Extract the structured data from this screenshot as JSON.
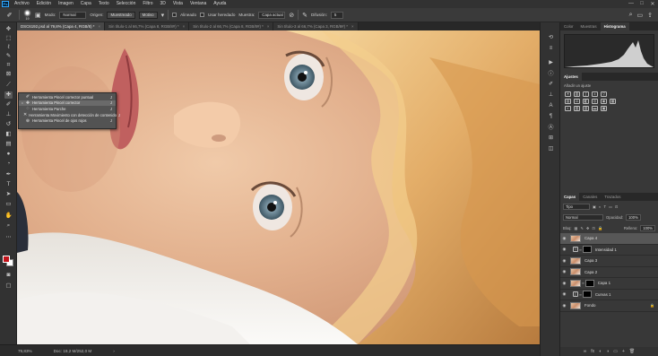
{
  "app": {
    "logo": "Ps"
  },
  "menu": [
    "Archivo",
    "Edición",
    "Imagen",
    "Capa",
    "Texto",
    "Selección",
    "Filtro",
    "3D",
    "Vista",
    "Ventana",
    "Ayuda"
  ],
  "window_controls": [
    "—",
    "□",
    "✕"
  ],
  "options_bar": {
    "brush_size": "19",
    "modo_label": "Modo:",
    "modo_value": "Normal",
    "origen_label": "Origen:",
    "origen_sampled": "Muestreado",
    "origen_pattern": "Motivo",
    "aligned_label": "Alineado",
    "legacy_label": "Usar heredado",
    "sample_label": "Muestra:",
    "sample_value": "Capa actual",
    "difusion_label": "Difusión:",
    "difusion_value": "5"
  },
  "tabs": [
    {
      "label": "DSC6192.psd al 79,8% (Capa 4, RGB/8) *",
      "active": true
    },
    {
      "label": "Sin título-1 al 66,7% (Capa 8, RGB/8#) *",
      "active": false
    },
    {
      "label": "Sin título-2 al 66,7% (Capa 8, RGB/8#) *",
      "active": false
    },
    {
      "label": "Sin título-3 al 66,7% (Capa 3, RGB/8#) *",
      "active": false
    }
  ],
  "tools": [
    {
      "icon": "move-icon",
      "glyph": "✥"
    },
    {
      "icon": "marquee-icon",
      "glyph": "⬚"
    },
    {
      "icon": "lasso-icon",
      "glyph": "ℓ"
    },
    {
      "icon": "quick-select-icon",
      "glyph": "✎"
    },
    {
      "icon": "crop-icon",
      "glyph": "⌗"
    },
    {
      "icon": "frame-icon",
      "glyph": "⊠"
    },
    {
      "icon": "eyedropper-icon",
      "glyph": "⟋"
    },
    {
      "icon": "healing-brush-icon",
      "glyph": "✚"
    },
    {
      "icon": "brush-icon",
      "glyph": "✐"
    },
    {
      "icon": "clone-stamp-icon",
      "glyph": "⊥"
    },
    {
      "icon": "history-brush-icon",
      "glyph": "↺"
    },
    {
      "icon": "eraser-icon",
      "glyph": "◧"
    },
    {
      "icon": "gradient-icon",
      "glyph": "▤"
    },
    {
      "icon": "blur-icon",
      "glyph": "●"
    },
    {
      "icon": "dodge-icon",
      "glyph": "◔"
    },
    {
      "icon": "pen-icon",
      "glyph": "✒"
    },
    {
      "icon": "type-icon",
      "glyph": "T"
    },
    {
      "icon": "path-select-icon",
      "glyph": "➤"
    },
    {
      "icon": "rectangle-icon",
      "glyph": "▭"
    },
    {
      "icon": "hand-icon",
      "glyph": "✋"
    },
    {
      "icon": "zoom-icon",
      "glyph": "⌕"
    },
    {
      "icon": "more-tools-icon",
      "glyph": "⋯"
    }
  ],
  "flyout": [
    {
      "label": "Herramienta Pincel corrector puntual",
      "key": "J",
      "selected": false,
      "bullet": ""
    },
    {
      "label": "Herramienta Pincel corrector",
      "key": "J",
      "selected": true,
      "bullet": "•"
    },
    {
      "label": "Herramienta Parche",
      "key": "J",
      "selected": false,
      "bullet": ""
    },
    {
      "label": "Herramienta Movimiento con detección de contenido",
      "key": "J",
      "selected": false,
      "bullet": ""
    },
    {
      "label": "Herramienta Pincel de ojos rojos",
      "key": "J",
      "selected": false,
      "bullet": ""
    }
  ],
  "status": {
    "zoom": "79,83%",
    "doc": "Doc: 19,2 M/252,0 M"
  },
  "right_panel": {
    "top_tabs": [
      {
        "label": "Color",
        "active": false
      },
      {
        "label": "Muestras",
        "active": false
      },
      {
        "label": "Histograma",
        "active": true
      }
    ],
    "adjust_tab": "Ajustes",
    "adjust_hint": "Añadir un ajuste",
    "layer_tabs": [
      {
        "label": "Capas",
        "active": true
      },
      {
        "label": "Canales",
        "active": false
      },
      {
        "label": "Trazados",
        "active": false
      }
    ],
    "filter_kind": "Tipo",
    "blend_mode": "Normal",
    "opacity_label": "Opacidad:",
    "opacity_value": "100%",
    "lock_label": "Bloq:",
    "fill_label": "Relleno:",
    "fill_value": "100%",
    "layers": [
      {
        "name": "Capa 4",
        "kind": "pixel",
        "selected": true
      },
      {
        "name": "Intensidad 1",
        "kind": "adjust",
        "selected": false
      },
      {
        "name": "Capa 3",
        "kind": "pixel",
        "selected": false
      },
      {
        "name": "Capa 2",
        "kind": "pixel",
        "selected": false
      },
      {
        "name": "Capa 1",
        "kind": "pixel-mask",
        "selected": false
      },
      {
        "name": "Curvas 1",
        "kind": "adjust",
        "selected": false
      },
      {
        "name": "Fondo",
        "kind": "pixel",
        "selected": false
      }
    ],
    "bottom_icons": [
      "∞",
      "fx",
      "◐",
      "◑",
      "▭",
      "+",
      "🗑"
    ]
  }
}
